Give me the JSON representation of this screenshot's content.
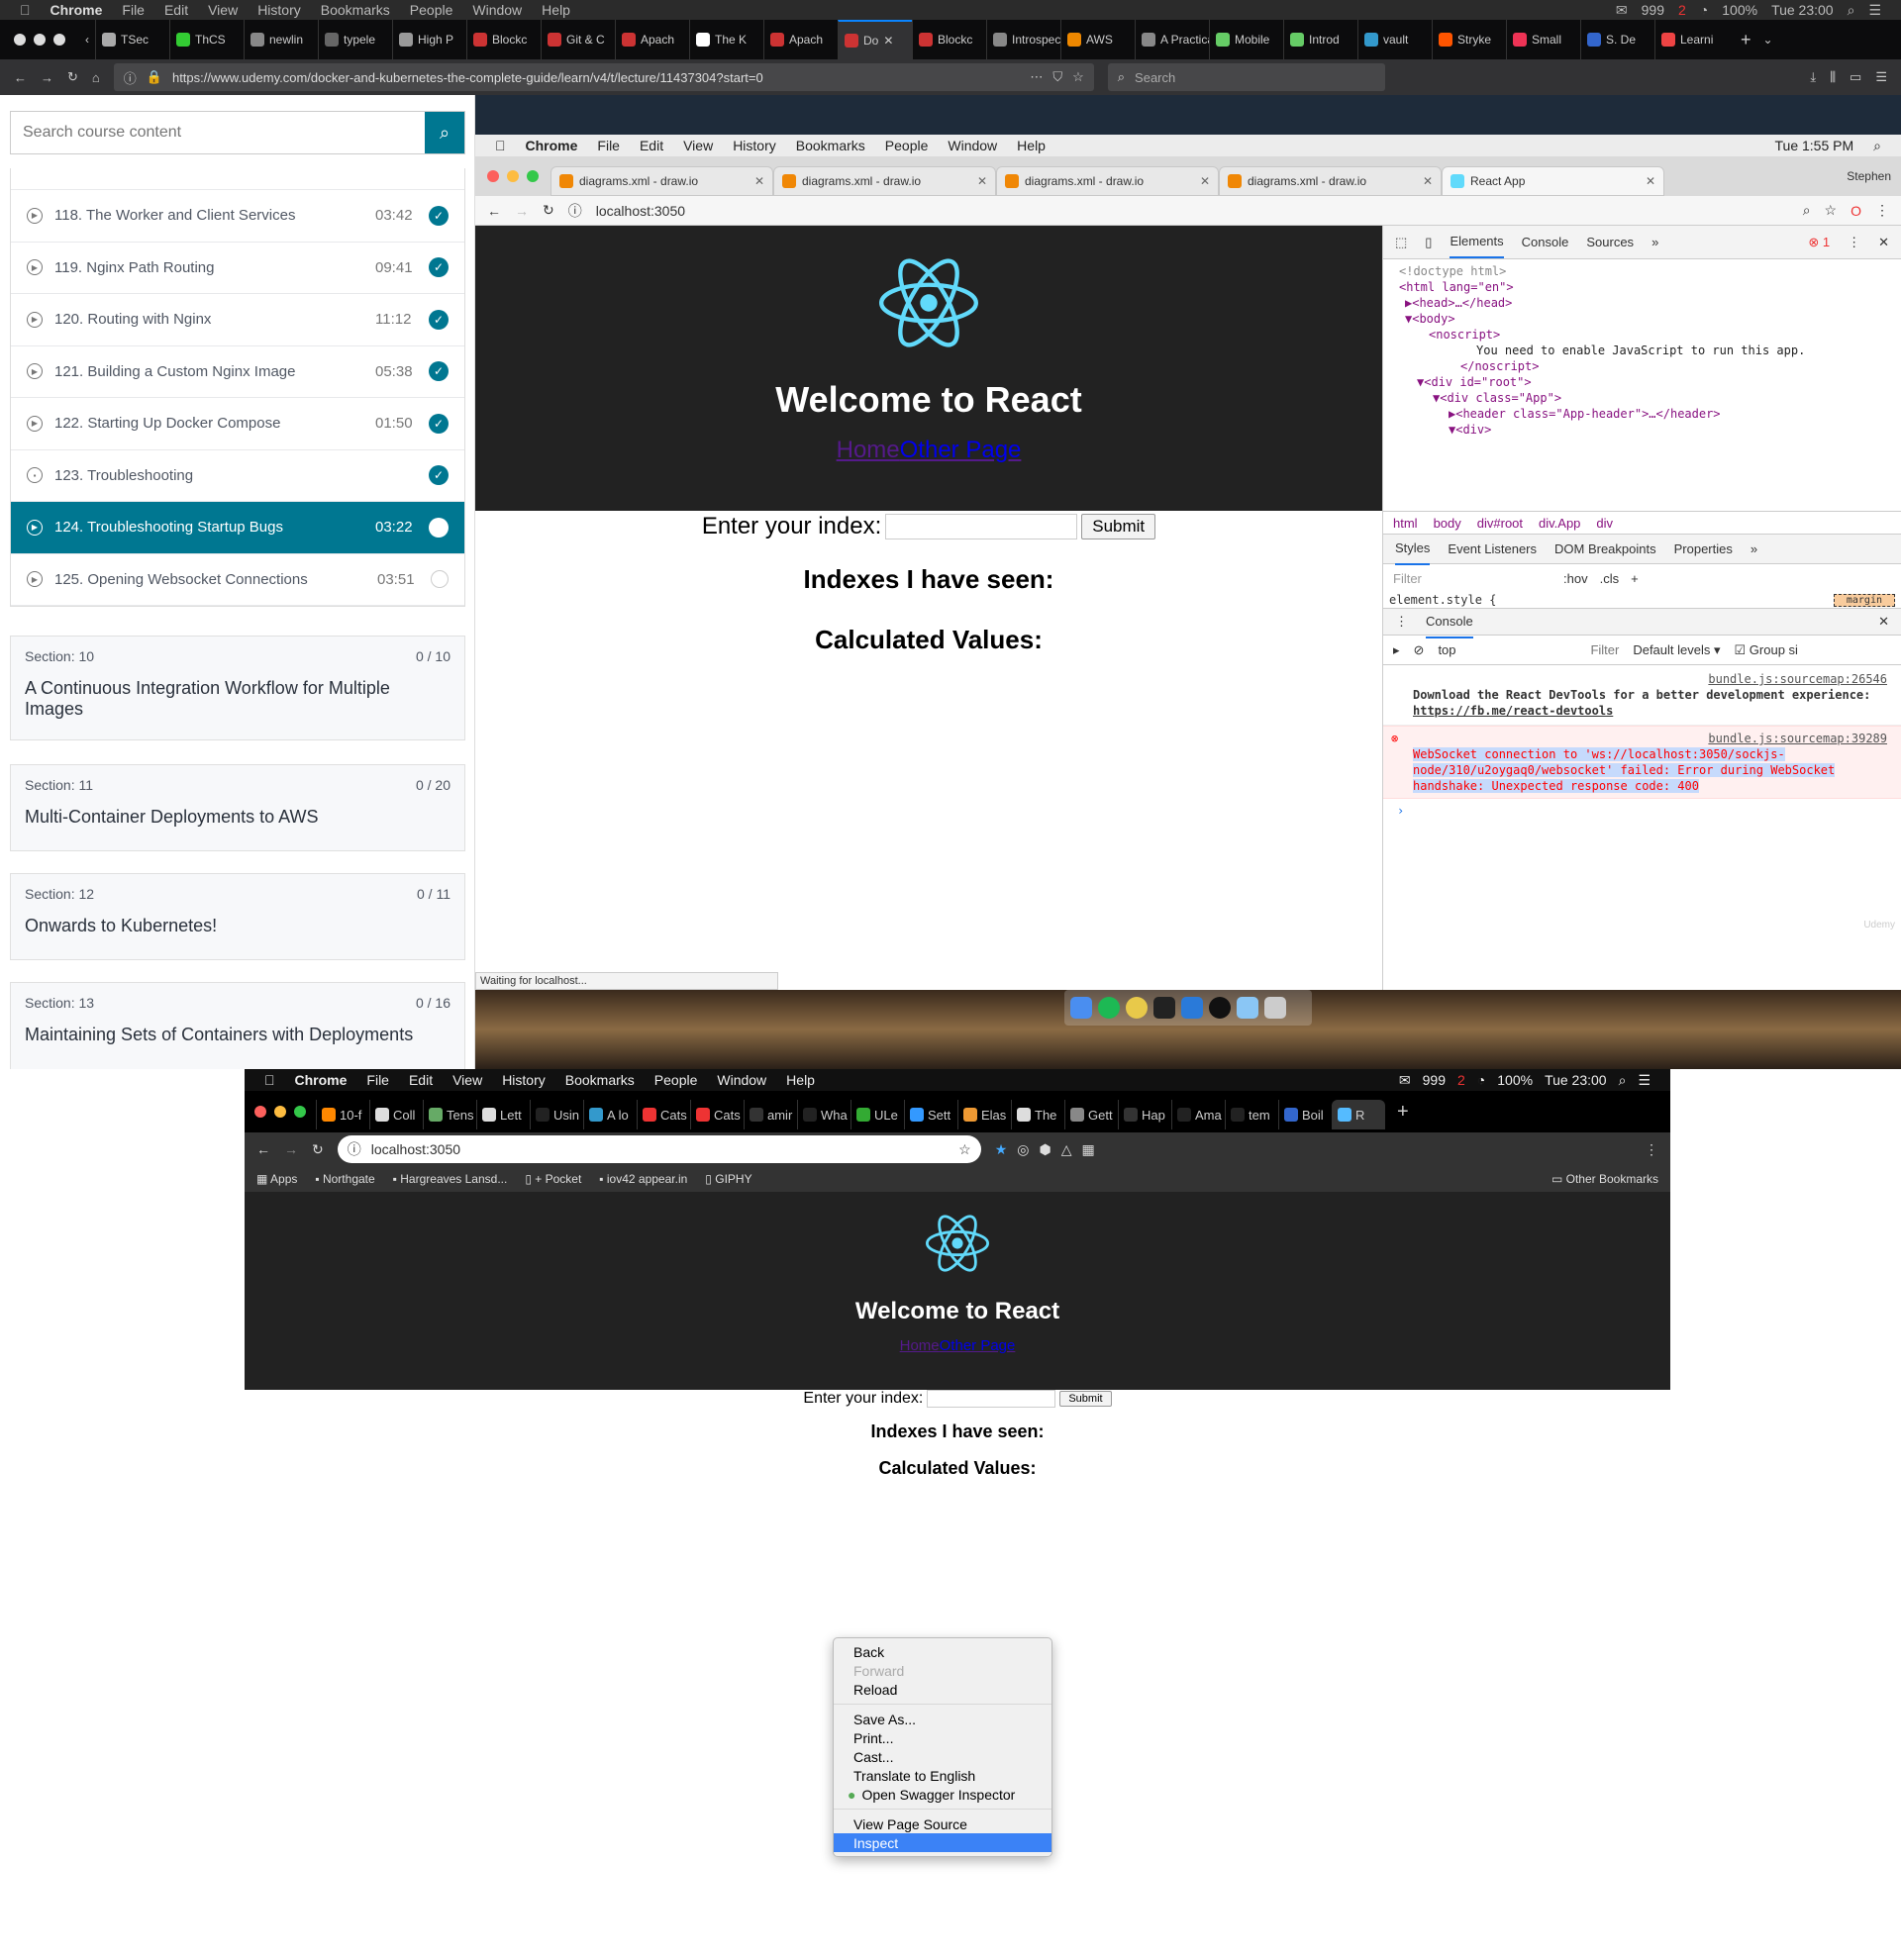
{
  "mac_menu": {
    "apple": "",
    "app": "Chrome",
    "items": [
      "File",
      "Edit",
      "View",
      "History",
      "Bookmarks",
      "People",
      "Window",
      "Help"
    ],
    "battery": "100%",
    "mail_count": "999",
    "badge": "2",
    "time": "Tue 23:00"
  },
  "browser": {
    "tabs": [
      "TSec",
      "ThCS",
      "newlin",
      "typele",
      "High P",
      "Blockc",
      "Git & C",
      "Apach",
      "The K",
      "Apach",
      "Do",
      "Blockc",
      "Introspect",
      "AWS",
      "A Practical",
      "Mobile",
      "Introd",
      "vault",
      "Stryke",
      "Small",
      "S. De",
      "Learni"
    ],
    "active_tab_index": 10,
    "url": "https://www.udemy.com/docker-and-kubernetes-the-complete-guide/learn/v4/t/lecture/11437304?start=0",
    "search_placeholder": "Search"
  },
  "course": {
    "search_placeholder": "Search course content",
    "lectures": [
      {
        "title": "118. The Worker and Client Services",
        "duration": "03:42",
        "done": true,
        "active": false,
        "icon": "play"
      },
      {
        "title": "119. Nginx Path Routing",
        "duration": "09:41",
        "done": true,
        "active": false,
        "icon": "play"
      },
      {
        "title": "120. Routing with Nginx",
        "duration": "11:12",
        "done": true,
        "active": false,
        "icon": "play"
      },
      {
        "title": "121. Building a Custom Nginx Image",
        "duration": "05:38",
        "done": true,
        "active": false,
        "icon": "play"
      },
      {
        "title": "122. Starting Up Docker Compose",
        "duration": "01:50",
        "done": true,
        "active": false,
        "icon": "play"
      },
      {
        "title": "123. Troubleshooting",
        "duration": "",
        "done": true,
        "active": false,
        "icon": "doc"
      },
      {
        "title": "124. Troubleshooting Startup Bugs",
        "duration": "03:22",
        "done": false,
        "active": true,
        "icon": "play"
      },
      {
        "title": "125. Opening Websocket Connections",
        "duration": "03:51",
        "done": false,
        "active": false,
        "icon": "play"
      }
    ],
    "sections": [
      {
        "label": "Section: 10",
        "progress": "0 / 10",
        "name": "A Continuous Integration Workflow for Multiple Images"
      },
      {
        "label": "Section: 11",
        "progress": "0 / 20",
        "name": "Multi-Container Deployments to AWS"
      },
      {
        "label": "Section: 12",
        "progress": "0 / 11",
        "name": "Onwards to Kubernetes!"
      },
      {
        "label": "Section: 13",
        "progress": "0 / 16",
        "name": "Maintaining Sets of Containers with Deployments"
      }
    ]
  },
  "inner": {
    "menu": {
      "app": "Chrome",
      "items": [
        "File",
        "Edit",
        "View",
        "History",
        "Bookmarks",
        "People",
        "Window",
        "Help"
      ],
      "time": "Tue 1:55 PM"
    },
    "tabs": [
      "diagrams.xml - draw.io",
      "diagrams.xml - draw.io",
      "diagrams.xml - draw.io",
      "diagrams.xml - draw.io",
      "React App"
    ],
    "profile": "Stephen",
    "url": "localhost:3050",
    "status": "Waiting for localhost..."
  },
  "react_app": {
    "title": "Welcome to React",
    "link_home": "Home",
    "link_other": "Other Page",
    "index_label": "Enter your index:",
    "submit": "Submit",
    "indexes_heading": "Indexes I have seen:",
    "values_heading": "Calculated Values:"
  },
  "devtools": {
    "tabs": [
      "Elements",
      "Console",
      "Sources",
      "»"
    ],
    "error_count": "1",
    "dom_lines": [
      "<!doctype html>",
      "<html lang=\"en\">",
      "▶<head>…</head>",
      "▼<body>",
      "<noscript>",
      "You need to enable JavaScript to run this app.",
      "</noscript>",
      "▼<div id=\"root\">",
      "▼<div class=\"App\">",
      "▶<header class=\"App-header\">…</header>",
      "▼<div>"
    ],
    "breadcrumbs": [
      "html",
      "body",
      "div#root",
      "div.App",
      "div"
    ],
    "sub_tabs": [
      "Styles",
      "Event Listeners",
      "DOM Breakpoints",
      "Properties",
      "»"
    ],
    "filter_placeholder": "Filter",
    "hov": ":hov",
    "cls": ".cls",
    "element_style": "element.style {",
    "margin_label": "margin",
    "console_title": "Console",
    "context": "top",
    "console_filter": "Filter",
    "levels": "Default levels ▾",
    "group": "Group si",
    "msg1_src": "bundle.js:sourcemap:26546",
    "msg1_text": "Download the React DevTools for a better development experience: ",
    "msg1_link": "https://fb.me/react-devtools",
    "err_src": "bundle.js:sourcemap:39289",
    "err_text": "WebSocket connection to 'ws://localhost:3050/sockjs-node/310/u2oygaq0/websocket' failed: Error during WebSocket handshake: Unexpected response code: 400",
    "watermark": "Udemy"
  },
  "bottom": {
    "menu": {
      "app": "Chrome",
      "items": [
        "File",
        "Edit",
        "View",
        "History",
        "Bookmarks",
        "People",
        "Window",
        "Help"
      ],
      "mail": "999",
      "badge": "2",
      "battery": "100%",
      "time": "Tue 23:00"
    },
    "tabs": [
      "10-f",
      "Coll",
      "Tens",
      "Lett",
      "Usin",
      "A lo",
      "Cats",
      "Cats",
      "amir",
      "Wha",
      "ULe",
      "Sett",
      "Elas",
      "The",
      "Gett",
      "Hap",
      "Ama",
      "tem",
      "Boil",
      "R"
    ],
    "url": "localhost:3050",
    "bookmarks": [
      "Apps",
      "Northgate",
      "Hargreaves Lansd...",
      "+ Pocket",
      "iov42 appear.in",
      "GIPHY"
    ],
    "other_bookmarks": "Other Bookmarks",
    "context_menu": {
      "items": [
        "Back",
        "Forward",
        "Reload",
        "Save As...",
        "Print...",
        "Cast...",
        "Translate to English",
        "Open Swagger Inspector",
        "View Page Source",
        "Inspect"
      ],
      "disabled": [
        "Forward"
      ],
      "highlighted": "Inspect"
    }
  }
}
